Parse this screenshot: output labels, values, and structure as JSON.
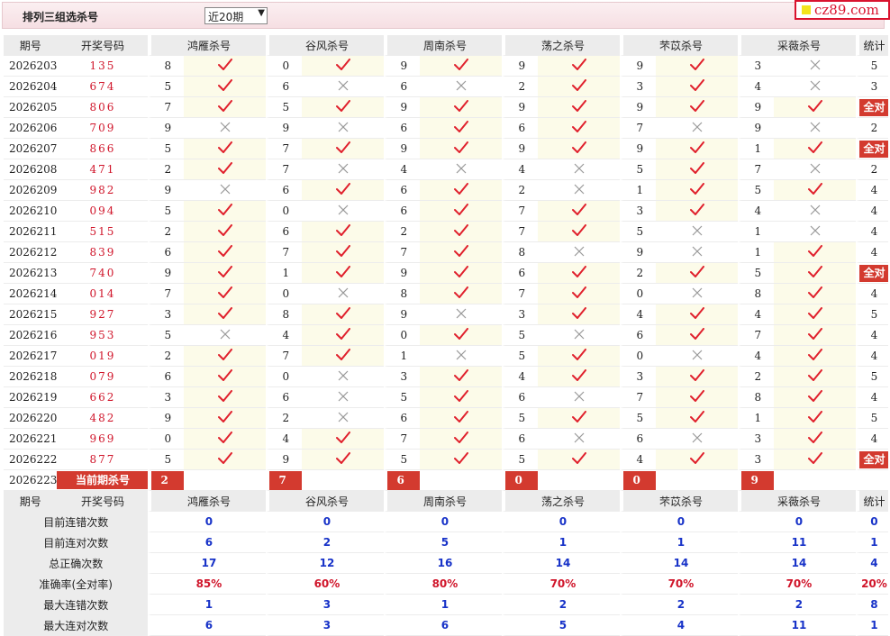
{
  "page": {
    "title": "排列三组选杀号",
    "period_select": "近20期",
    "logo_text": "cz89.com"
  },
  "headers": {
    "issue": "期号",
    "draw": "开奖号码",
    "stat": "统计",
    "experts": [
      "鸿雁杀号",
      "谷风杀号",
      "周南杀号",
      "荡之杀号",
      "芣苡杀号",
      "采薇杀号"
    ]
  },
  "rows": [
    {
      "issue": "2026203",
      "draw": "135",
      "picks": [
        [
          "8",
          "ok"
        ],
        [
          "0",
          "ok"
        ],
        [
          "9",
          "ok"
        ],
        [
          "9",
          "ok"
        ],
        [
          "9",
          "ok"
        ],
        [
          "3",
          "x"
        ]
      ],
      "stat": "5"
    },
    {
      "issue": "2026204",
      "draw": "674",
      "picks": [
        [
          "5",
          "ok"
        ],
        [
          "6",
          "x"
        ],
        [
          "6",
          "x"
        ],
        [
          "2",
          "ok"
        ],
        [
          "3",
          "ok"
        ],
        [
          "4",
          "x"
        ]
      ],
      "stat": "3"
    },
    {
      "issue": "2026205",
      "draw": "806",
      "picks": [
        [
          "7",
          "ok"
        ],
        [
          "5",
          "ok"
        ],
        [
          "9",
          "ok"
        ],
        [
          "9",
          "ok"
        ],
        [
          "9",
          "ok"
        ],
        [
          "9",
          "ok"
        ]
      ],
      "stat": "全对"
    },
    {
      "issue": "2026206",
      "draw": "709",
      "picks": [
        [
          "9",
          "x"
        ],
        [
          "9",
          "x"
        ],
        [
          "6",
          "ok"
        ],
        [
          "6",
          "ok"
        ],
        [
          "7",
          "x"
        ],
        [
          "9",
          "x"
        ]
      ],
      "stat": "2"
    },
    {
      "issue": "2026207",
      "draw": "866",
      "picks": [
        [
          "5",
          "ok"
        ],
        [
          "7",
          "ok"
        ],
        [
          "9",
          "ok"
        ],
        [
          "9",
          "ok"
        ],
        [
          "9",
          "ok"
        ],
        [
          "1",
          "ok"
        ]
      ],
      "stat": "全对"
    },
    {
      "issue": "2026208",
      "draw": "471",
      "picks": [
        [
          "2",
          "ok"
        ],
        [
          "7",
          "x"
        ],
        [
          "4",
          "x"
        ],
        [
          "4",
          "x"
        ],
        [
          "5",
          "ok"
        ],
        [
          "7",
          "x"
        ]
      ],
      "stat": "2"
    },
    {
      "issue": "2026209",
      "draw": "982",
      "picks": [
        [
          "9",
          "x"
        ],
        [
          "6",
          "ok"
        ],
        [
          "6",
          "ok"
        ],
        [
          "2",
          "x"
        ],
        [
          "1",
          "ok"
        ],
        [
          "5",
          "ok"
        ]
      ],
      "stat": "4"
    },
    {
      "issue": "2026210",
      "draw": "094",
      "picks": [
        [
          "5",
          "ok"
        ],
        [
          "0",
          "x"
        ],
        [
          "6",
          "ok"
        ],
        [
          "7",
          "ok"
        ],
        [
          "3",
          "ok"
        ],
        [
          "4",
          "x"
        ]
      ],
      "stat": "4"
    },
    {
      "issue": "2026211",
      "draw": "515",
      "picks": [
        [
          "2",
          "ok"
        ],
        [
          "6",
          "ok"
        ],
        [
          "2",
          "ok"
        ],
        [
          "7",
          "ok"
        ],
        [
          "5",
          "x"
        ],
        [
          "1",
          "x"
        ]
      ],
      "stat": "4"
    },
    {
      "issue": "2026212",
      "draw": "839",
      "picks": [
        [
          "6",
          "ok"
        ],
        [
          "7",
          "ok"
        ],
        [
          "7",
          "ok"
        ],
        [
          "8",
          "x"
        ],
        [
          "9",
          "x"
        ],
        [
          "1",
          "ok"
        ]
      ],
      "stat": "4"
    },
    {
      "issue": "2026213",
      "draw": "740",
      "picks": [
        [
          "9",
          "ok"
        ],
        [
          "1",
          "ok"
        ],
        [
          "9",
          "ok"
        ],
        [
          "6",
          "ok"
        ],
        [
          "2",
          "ok"
        ],
        [
          "5",
          "ok"
        ]
      ],
      "stat": "全对"
    },
    {
      "issue": "2026214",
      "draw": "014",
      "picks": [
        [
          "7",
          "ok"
        ],
        [
          "0",
          "x"
        ],
        [
          "8",
          "ok"
        ],
        [
          "7",
          "ok"
        ],
        [
          "0",
          "x"
        ],
        [
          "8",
          "ok"
        ]
      ],
      "stat": "4"
    },
    {
      "issue": "2026215",
      "draw": "927",
      "picks": [
        [
          "3",
          "ok"
        ],
        [
          "8",
          "ok"
        ],
        [
          "9",
          "x"
        ],
        [
          "3",
          "ok"
        ],
        [
          "4",
          "ok"
        ],
        [
          "4",
          "ok"
        ]
      ],
      "stat": "5"
    },
    {
      "issue": "2026216",
      "draw": "953",
      "picks": [
        [
          "5",
          "x"
        ],
        [
          "4",
          "ok"
        ],
        [
          "0",
          "ok"
        ],
        [
          "5",
          "x"
        ],
        [
          "6",
          "ok"
        ],
        [
          "7",
          "ok"
        ]
      ],
      "stat": "4"
    },
    {
      "issue": "2026217",
      "draw": "019",
      "picks": [
        [
          "2",
          "ok"
        ],
        [
          "7",
          "ok"
        ],
        [
          "1",
          "x"
        ],
        [
          "5",
          "ok"
        ],
        [
          "0",
          "x"
        ],
        [
          "4",
          "ok"
        ]
      ],
      "stat": "4"
    },
    {
      "issue": "2026218",
      "draw": "079",
      "picks": [
        [
          "6",
          "ok"
        ],
        [
          "0",
          "x"
        ],
        [
          "3",
          "ok"
        ],
        [
          "4",
          "ok"
        ],
        [
          "3",
          "ok"
        ],
        [
          "2",
          "ok"
        ]
      ],
      "stat": "5"
    },
    {
      "issue": "2026219",
      "draw": "662",
      "picks": [
        [
          "3",
          "ok"
        ],
        [
          "6",
          "x"
        ],
        [
          "5",
          "ok"
        ],
        [
          "6",
          "x"
        ],
        [
          "7",
          "ok"
        ],
        [
          "8",
          "ok"
        ]
      ],
      "stat": "4"
    },
    {
      "issue": "2026220",
      "draw": "482",
      "picks": [
        [
          "9",
          "ok"
        ],
        [
          "2",
          "x"
        ],
        [
          "6",
          "ok"
        ],
        [
          "5",
          "ok"
        ],
        [
          "5",
          "ok"
        ],
        [
          "1",
          "ok"
        ]
      ],
      "stat": "5"
    },
    {
      "issue": "2026221",
      "draw": "969",
      "picks": [
        [
          "0",
          "ok"
        ],
        [
          "4",
          "ok"
        ],
        [
          "7",
          "ok"
        ],
        [
          "6",
          "x"
        ],
        [
          "6",
          "x"
        ],
        [
          "3",
          "ok"
        ]
      ],
      "stat": "4"
    },
    {
      "issue": "2026222",
      "draw": "877",
      "picks": [
        [
          "5",
          "ok"
        ],
        [
          "9",
          "ok"
        ],
        [
          "5",
          "ok"
        ],
        [
          "5",
          "ok"
        ],
        [
          "4",
          "ok"
        ],
        [
          "3",
          "ok"
        ]
      ],
      "stat": "全对"
    }
  ],
  "current": {
    "issue": "2026223",
    "label": "当前期杀号",
    "picks": [
      "2",
      "7",
      "6",
      "0",
      "0",
      "9"
    ]
  },
  "summary": [
    {
      "label": "目前连错次数",
      "values": [
        "0",
        "0",
        "0",
        "0",
        "0",
        "0",
        "0"
      ]
    },
    {
      "label": "目前连对次数",
      "values": [
        "6",
        "2",
        "5",
        "1",
        "1",
        "11",
        "1"
      ]
    },
    {
      "label": "总正确次数",
      "values": [
        "17",
        "12",
        "16",
        "14",
        "14",
        "14",
        "4"
      ]
    },
    {
      "label": "准确率(全对率)",
      "values": [
        "85%",
        "60%",
        "80%",
        "70%",
        "70%",
        "70%",
        "20%"
      ],
      "red": true
    },
    {
      "label": "最大连错次数",
      "values": [
        "1",
        "3",
        "1",
        "2",
        "2",
        "2",
        "8"
      ]
    },
    {
      "label": "最大连对次数",
      "values": [
        "6",
        "3",
        "6",
        "5",
        "4",
        "11",
        "1"
      ]
    }
  ],
  "icons": {
    "ok": "check-icon",
    "x": "cross-icon"
  },
  "colors": {
    "accent_red": "#d33a2f",
    "number_red": "#d0152a",
    "value_blue": "#1732c8"
  }
}
